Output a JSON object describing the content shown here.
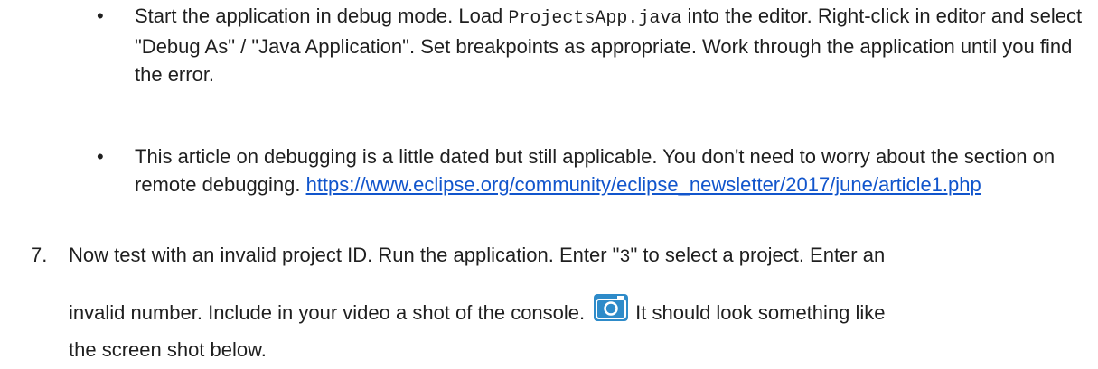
{
  "bullets": [
    {
      "symbol": "•",
      "text_before": "Start the application in debug mode. Load ",
      "code": "ProjectsApp.java",
      "text_after": " into the editor. Right-click in editor and select \"Debug As\" / \"Java Application\". Set breakpoints as appropriate. Work through the application until you find the error."
    },
    {
      "symbol": "•",
      "text": "This article on debugging is a little dated but still applicable. You don't need to worry about the section on remote debugging. ",
      "link": "https://www.eclipse.org/community/eclipse_newsletter/2017/june/article1.php"
    }
  ],
  "step7": {
    "number": "7.",
    "part1": "Now test with an invalid project ID. Run the application. Enter \"",
    "code": "3",
    "part2": "\" to select a project. Enter an",
    "part3": "invalid number. Include in your video a shot of the console.",
    "part4": "It should look something like",
    "part5": "the screen shot below."
  },
  "colors": {
    "link": "#1155cc",
    "camera_icon": "#2e8bc9"
  },
  "icons": {
    "camera": "camera-icon"
  }
}
